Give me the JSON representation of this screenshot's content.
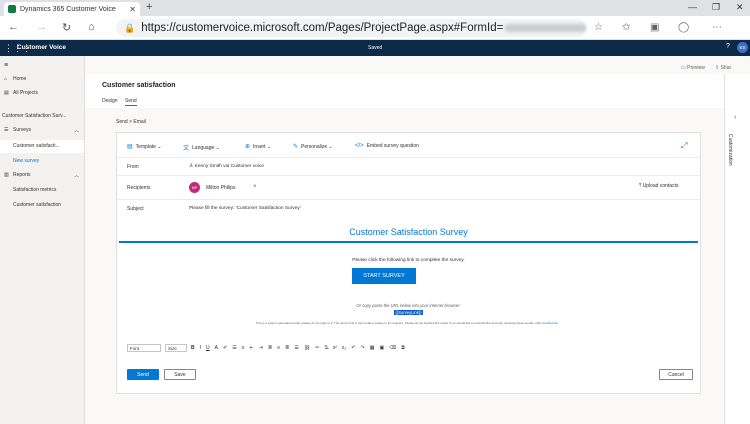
{
  "browser": {
    "tab_title": "Dynamics 365 Customer Voice",
    "tab_close": "✕",
    "new_tab": "+",
    "url": "https://customervoice.microsoft.com/Pages/ProjectPage.aspx#FormId=",
    "icons": [
      "back-icon",
      "forward-icon",
      "refresh-icon",
      "home-icon",
      "lock-icon",
      "star-icon",
      "collections-icon",
      "profile-icon",
      "more-icon"
    ]
  },
  "app": {
    "name": "Customer Voice",
    "status": "Saved",
    "help": "?",
    "avatar_initials": "KS"
  },
  "leftnav": {
    "home": "Home",
    "all_projects": "All Projects",
    "project": "Customer Satisfaction Surv...",
    "surveys": "Surveys",
    "survey_item": "Customer satisfacti...",
    "new_survey": "New survey",
    "reports": "Reports",
    "report_items": [
      "Satisfaction metrics",
      "Customer satisfaction"
    ]
  },
  "commands": {
    "preview": "Preview",
    "share": "Shar"
  },
  "page": {
    "title": "Customer satisfaction",
    "tabs": [
      "Design",
      "Send"
    ],
    "breadcrumb": "Send  >  Email"
  },
  "editor": {
    "toolbar": [
      "Template",
      "Language",
      "Insert",
      "Personalize",
      "Embed survey question"
    ],
    "from_label": "From",
    "from_value": "Kenny Smith via Customer voice",
    "recipients_label": "Recipients",
    "recipient_initials": "MP",
    "recipient_name": "Milton Philips",
    "upload_contacts": "Upload contacts",
    "subject_label": "Subject",
    "subject_value": "Please fill the survey: 'Customer Satisfaction Survey'",
    "survey_title": "Customer Satisfaction Survey",
    "instruction": "Please click the following link to complete the survey.",
    "start_button": "START SURVEY",
    "copy_text": "Or copy paste the URL below into your internet browser:",
    "survey_link": "{{SurveyLink}}",
    "fine_print": "This is a system generated email, please do not reply to it. The survey link in this email is unique to its recipient. Please do not forward this email. If you would like to unsubscribe and stop receiving these emails, click",
    "unsubscribe": "unsubscribe",
    "font_label": "Font",
    "size_label": "Size",
    "send": "Send",
    "save": "Save",
    "cancel": "Cancel"
  },
  "right_panel": {
    "label": "Customization"
  },
  "colors": {
    "accent": "#0078d4",
    "header": "#0b2a4a",
    "recipient_avatar": "#c4287a"
  }
}
